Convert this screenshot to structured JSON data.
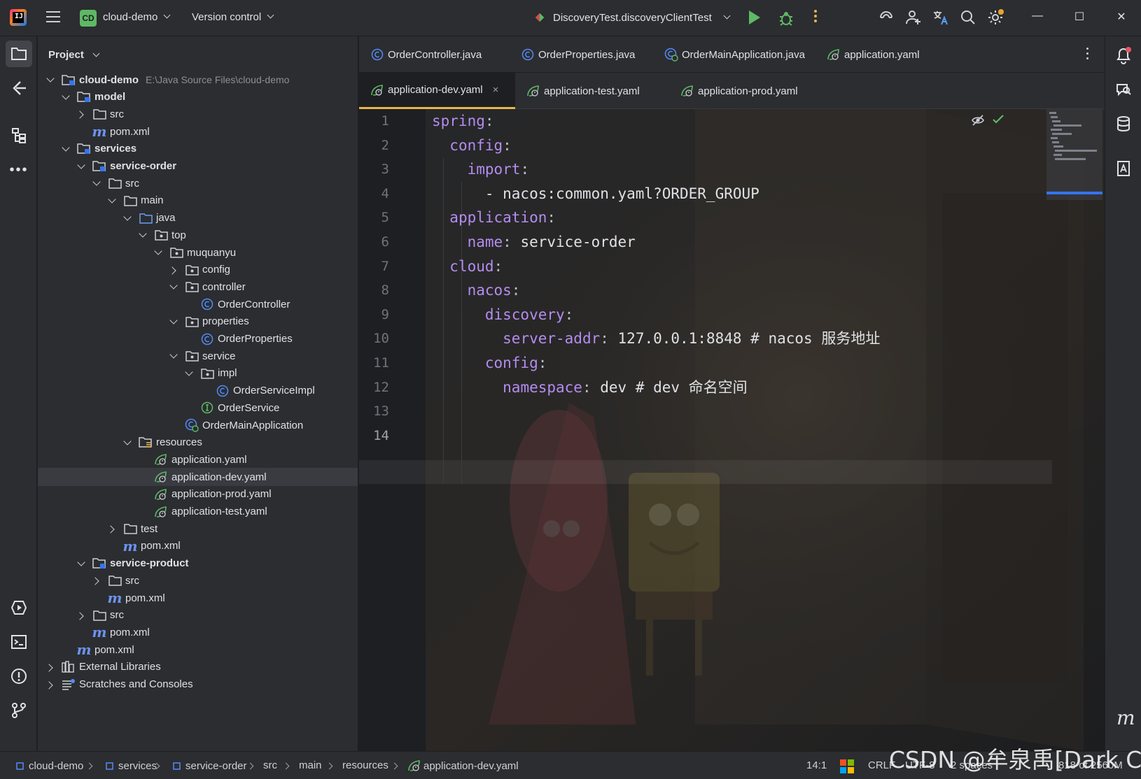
{
  "titlebar": {
    "project_badge": "CD",
    "project_name": "cloud-demo",
    "vcs_label": "Version control",
    "run_config": "DiscoveryTest.discoveryClientTest"
  },
  "project_panel": {
    "title": "Project",
    "root_path": "E:\\Java Source Files\\cloud-demo"
  },
  "tree": [
    {
      "label": "cloud-demo",
      "depth": 0,
      "tw": "open",
      "icon": "module-folder",
      "bold": true,
      "hint": true
    },
    {
      "label": "model",
      "depth": 1,
      "tw": "open",
      "icon": "module-folder",
      "bold": true
    },
    {
      "label": "src",
      "depth": 2,
      "tw": "closed",
      "icon": "folder"
    },
    {
      "label": "pom.xml",
      "depth": 2,
      "tw": "none",
      "icon": "maven"
    },
    {
      "label": "services",
      "depth": 1,
      "tw": "open",
      "icon": "module-folder",
      "bold": true
    },
    {
      "label": "service-order",
      "depth": 2,
      "tw": "open",
      "icon": "module-folder",
      "bold": true
    },
    {
      "label": "src",
      "depth": 3,
      "tw": "open",
      "icon": "folder"
    },
    {
      "label": "main",
      "depth": 4,
      "tw": "open",
      "icon": "folder"
    },
    {
      "label": "java",
      "depth": 5,
      "tw": "open",
      "icon": "source-folder"
    },
    {
      "label": "top",
      "depth": 6,
      "tw": "open",
      "icon": "package"
    },
    {
      "label": "muquanyu",
      "depth": 7,
      "tw": "open",
      "icon": "package"
    },
    {
      "label": "config",
      "depth": 8,
      "tw": "closed",
      "icon": "package"
    },
    {
      "label": "controller",
      "depth": 8,
      "tw": "open",
      "icon": "package"
    },
    {
      "label": "OrderController",
      "depth": 9,
      "tw": "none",
      "icon": "class"
    },
    {
      "label": "properties",
      "depth": 8,
      "tw": "open",
      "icon": "package"
    },
    {
      "label": "OrderProperties",
      "depth": 9,
      "tw": "none",
      "icon": "class"
    },
    {
      "label": "service",
      "depth": 8,
      "tw": "open",
      "icon": "package"
    },
    {
      "label": "impl",
      "depth": 9,
      "tw": "open",
      "icon": "package"
    },
    {
      "label": "OrderServiceImpl",
      "depth": 10,
      "tw": "none",
      "icon": "class"
    },
    {
      "label": "OrderService",
      "depth": 9,
      "tw": "none",
      "icon": "interface"
    },
    {
      "label": "OrderMainApplication",
      "depth": 8,
      "tw": "none",
      "icon": "spring-class"
    },
    {
      "label": "resources",
      "depth": 5,
      "tw": "open",
      "icon": "resources-folder"
    },
    {
      "label": "application.yaml",
      "depth": 6,
      "tw": "none",
      "icon": "yaml"
    },
    {
      "label": "application-dev.yaml",
      "depth": 6,
      "tw": "none",
      "icon": "yaml",
      "selected": true
    },
    {
      "label": "application-prod.yaml",
      "depth": 6,
      "tw": "none",
      "icon": "yaml"
    },
    {
      "label": "application-test.yaml",
      "depth": 6,
      "tw": "none",
      "icon": "yaml"
    },
    {
      "label": "test",
      "depth": 4,
      "tw": "closed",
      "icon": "folder"
    },
    {
      "label": "pom.xml",
      "depth": 4,
      "tw": "none",
      "icon": "maven"
    },
    {
      "label": "service-product",
      "depth": 2,
      "tw": "open",
      "icon": "module-folder",
      "bold": true
    },
    {
      "label": "src",
      "depth": 3,
      "tw": "closed",
      "icon": "folder"
    },
    {
      "label": "pom.xml",
      "depth": 3,
      "tw": "none",
      "icon": "maven"
    },
    {
      "label": "src",
      "depth": 2,
      "tw": "closed",
      "icon": "folder"
    },
    {
      "label": "pom.xml",
      "depth": 2,
      "tw": "none",
      "icon": "maven"
    },
    {
      "label": "pom.xml",
      "depth": 1,
      "tw": "none",
      "icon": "maven"
    },
    {
      "label": "External Libraries",
      "depth": 0,
      "tw": "closed",
      "icon": "libraries"
    },
    {
      "label": "Scratches and Consoles",
      "depth": 0,
      "tw": "closed",
      "icon": "scratches"
    }
  ],
  "tabs_row1": [
    {
      "label": "OrderController.java",
      "icon": "class"
    },
    {
      "label": "OrderProperties.java",
      "icon": "class"
    },
    {
      "label": "OrderMainApplication.java",
      "icon": "spring-class"
    },
    {
      "label": "application.yaml",
      "icon": "yaml"
    }
  ],
  "tabs_row2": [
    {
      "label": "application-dev.yaml",
      "icon": "yaml",
      "active": true,
      "close": "×"
    },
    {
      "label": "application-test.yaml",
      "icon": "yaml"
    },
    {
      "label": "application-prod.yaml",
      "icon": "yaml"
    }
  ],
  "code": {
    "line_numbers": [
      "1",
      "2",
      "3",
      "4",
      "5",
      "6",
      "7",
      "8",
      "9",
      "10",
      "11",
      "12",
      "13",
      "14"
    ],
    "lines": [
      [
        {
          "t": "spring",
          "c": "k"
        },
        {
          "t": ":",
          "c": "punc"
        }
      ],
      [
        {
          "t": "  "
        },
        {
          "t": "config",
          "c": "k"
        },
        {
          "t": ":",
          "c": "punc"
        }
      ],
      [
        {
          "t": "    "
        },
        {
          "t": "import",
          "c": "k"
        },
        {
          "t": ":",
          "c": "punc"
        }
      ],
      [
        {
          "t": "      - nacos:common.yaml?ORDER_GROUP",
          "c": "v"
        }
      ],
      [
        {
          "t": "  "
        },
        {
          "t": "application",
          "c": "k"
        },
        {
          "t": ":",
          "c": "punc"
        }
      ],
      [
        {
          "t": "    "
        },
        {
          "t": "name",
          "c": "k"
        },
        {
          "t": ": ",
          "c": "punc"
        },
        {
          "t": "service-order",
          "c": "v"
        }
      ],
      [
        {
          "t": "  "
        },
        {
          "t": "cloud",
          "c": "k"
        },
        {
          "t": ":",
          "c": "punc"
        }
      ],
      [
        {
          "t": "    "
        },
        {
          "t": "nacos",
          "c": "k"
        },
        {
          "t": ":",
          "c": "punc"
        }
      ],
      [
        {
          "t": "      "
        },
        {
          "t": "discovery",
          "c": "k"
        },
        {
          "t": ":",
          "c": "punc"
        }
      ],
      [
        {
          "t": "        "
        },
        {
          "t": "server-addr",
          "c": "k"
        },
        {
          "t": ": ",
          "c": "punc"
        },
        {
          "t": "127.0.0.1:8848 # nacos 服务地址",
          "c": "v"
        }
      ],
      [
        {
          "t": "      "
        },
        {
          "t": "config",
          "c": "k"
        },
        {
          "t": ":",
          "c": "punc"
        }
      ],
      [
        {
          "t": "        "
        },
        {
          "t": "namespace",
          "c": "k"
        },
        {
          "t": ": ",
          "c": "punc"
        },
        {
          "t": "dev # dev 命名空间",
          "c": "v"
        }
      ],
      [],
      []
    ]
  },
  "breadcrumbs": [
    "cloud-demo",
    "services",
    "service-order",
    "src",
    "main",
    "resources",
    "application-dev.yaml"
  ],
  "status": {
    "position": "14:1",
    "line_sep": "CRLF",
    "encoding": "UTF-8",
    "indent": "2 spaces",
    "memory": "818 of 2560M"
  },
  "watermark": "CSDN @牟泉禹[Dark Cat]",
  "colors": {
    "accent": "#3574f0",
    "key": "#b48cf0",
    "run": "#5fb865",
    "warn": "#e9b44c"
  }
}
